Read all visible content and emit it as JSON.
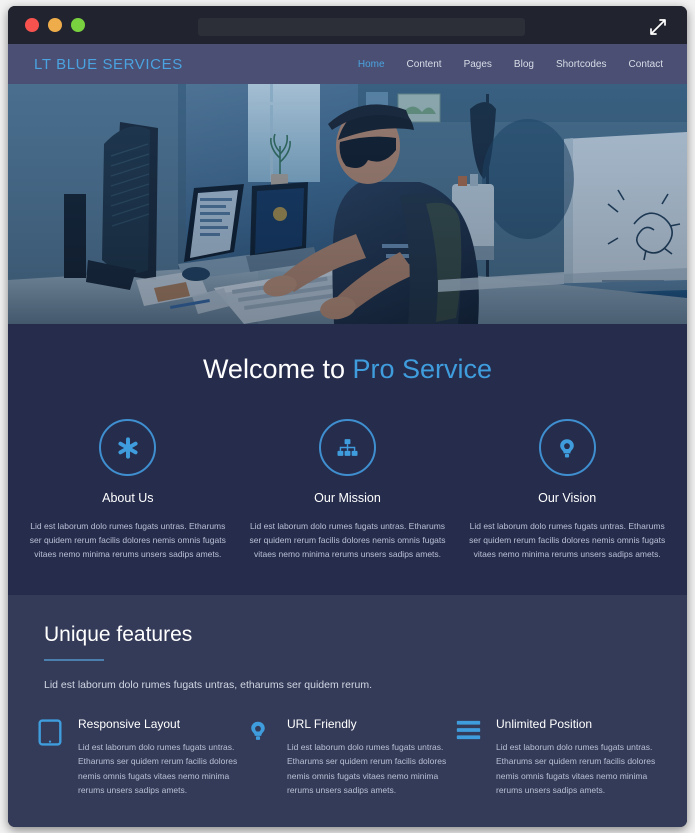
{
  "browser": {
    "address_value": "",
    "address_placeholder": "",
    "expand_icon": "expand-arrows-icon",
    "lights": [
      {
        "name": "close-button",
        "color": "#f8524f"
      },
      {
        "name": "minimize-button",
        "color": "#eead4a"
      },
      {
        "name": "maximize-button",
        "color": "#79d13f"
      }
    ]
  },
  "site": {
    "logo": "LT BLUE SERVICES",
    "nav": [
      {
        "label": "Home",
        "active": true
      },
      {
        "label": "Content",
        "active": false
      },
      {
        "label": "Pages",
        "active": false
      },
      {
        "label": "Blog",
        "active": false
      },
      {
        "label": "Shortcodes",
        "active": false
      },
      {
        "label": "Contact",
        "active": false
      }
    ]
  },
  "hero": {
    "alt": "Man wearing sunglasses and a hat working at a desk with monitors, laptops and a keyboard in a blue-toned room"
  },
  "welcome": {
    "title_plain": "Welcome to ",
    "title_accent": "Pro Service",
    "columns": [
      {
        "icon": "asterisk-icon",
        "title": "About Us",
        "text": "Lid est laborum dolo rumes fugats untras. Etharums ser quidem rerum facilis dolores nemis omnis fugats vitaes nemo minima rerums unsers sadips amets."
      },
      {
        "icon": "sitemap-icon",
        "title": "Our Mission",
        "text": "Lid est laborum dolo rumes fugats untras. Etharums ser quidem rerum facilis dolores nemis omnis fugats vitaes nemo minima rerums unsers sadips amets."
      },
      {
        "icon": "lightbulb-icon",
        "title": "Our Vision",
        "text": "Lid est laborum dolo rumes fugats untras. Etharums ser quidem rerum facilis dolores nemis omnis fugats vitaes nemo minima rerums unsers sadips amets."
      }
    ]
  },
  "features": {
    "heading": "Unique features",
    "subheading": "Lid est laborum dolo rumes fugats untras, etharums ser quidem rerum.",
    "items": [
      {
        "icon": "tablet-icon",
        "title": "Responsive Layout",
        "text": "Lid est laborum dolo rumes fugats untras. Etharums ser quidem rerum facilis dolores nemis omnis fugats vitaes nemo minima rerums unsers sadips amets."
      },
      {
        "icon": "lightbulb-icon",
        "title": "URL Friendly",
        "text": "Lid est laborum dolo rumes fugats untras. Etharums ser quidem rerum facilis dolores nemis omnis fugats vitaes nemo minima rerums unsers sadips amets."
      },
      {
        "icon": "bars-icon",
        "title": "Unlimited Position",
        "text": "Lid est laborum dolo rumes fugats untras. Etharums ser quidem rerum facilis dolores nemis omnis fugats vitaes nemo minima rerums unsers sadips amets."
      }
    ]
  },
  "colors": {
    "accent_blue": "#3f9ddd",
    "logo_blue": "#4aa3e0",
    "header_bg": "#4a4f73",
    "welcome_bg": "#262c4c",
    "features_bg": "#343b58",
    "chrome_bg": "#21242e"
  }
}
